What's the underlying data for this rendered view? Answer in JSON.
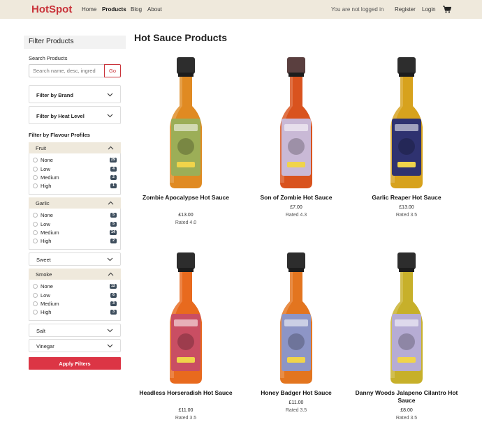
{
  "nav": {
    "brand": "HotSpot",
    "links": [
      "Home",
      "Products",
      "Blog",
      "About"
    ],
    "status": "You are not logged in",
    "register": "Register",
    "login": "Login",
    "cart_icon": "shopping-cart-icon"
  },
  "sidebar": {
    "title": "Filter Products",
    "search_label": "Search Products",
    "search_placeholder": "Search name, desc, ingred",
    "go_label": "Go",
    "brand_filter": "Filter by Brand",
    "heat_filter": "Filter by Heat Level",
    "flavour_title": "Filter by Flavour Profiles",
    "flavours": [
      {
        "name": "Fruit",
        "open": true,
        "options": [
          {
            "label": "None",
            "count": "29"
          },
          {
            "label": "Low",
            "count": "4"
          },
          {
            "label": "Medium",
            "count": "2"
          },
          {
            "label": "High",
            "count": "1"
          }
        ]
      },
      {
        "name": "Garlic",
        "open": true,
        "options": [
          {
            "label": "None",
            "count": "5"
          },
          {
            "label": "Low",
            "count": "5"
          },
          {
            "label": "Medium",
            "count": "14"
          },
          {
            "label": "High",
            "count": "2"
          }
        ]
      },
      {
        "name": "Sweet",
        "open": false
      },
      {
        "name": "Smoke",
        "open": true,
        "options": [
          {
            "label": "None",
            "count": "12"
          },
          {
            "label": "Low",
            "count": "6"
          },
          {
            "label": "Medium",
            "count": "3"
          },
          {
            "label": "High",
            "count": "3"
          }
        ]
      },
      {
        "name": "Salt",
        "open": false
      },
      {
        "name": "Vinegar",
        "open": false
      }
    ],
    "apply_label": "Apply Filters"
  },
  "main": {
    "title": "Hot Sauce Products",
    "products": [
      {
        "name": "Zombie Apocalypse Hot Sauce",
        "price": "£13.00",
        "rating": "Rated 4.0",
        "liquid": "#e08a22",
        "label": "#9cae57",
        "cap": "#2d2d2d"
      },
      {
        "name": "Son of Zombie Hot Sauce",
        "price": "£7.00",
        "rating": "Rated 4.3",
        "liquid": "#d9531e",
        "label": "#c9b9d6",
        "cap": "#5a3f3f"
      },
      {
        "name": "Garlic Reaper Hot Sauce",
        "price": "£13.00",
        "rating": "Rated 3.5",
        "liquid": "#d7a21d",
        "label": "#2f3270",
        "cap": "#2d2d2d"
      },
      {
        "name": "Headless Horseradish Hot Sauce",
        "price": "£11.00",
        "rating": "Rated 3.5",
        "liquid": "#e86a1e",
        "label": "#c94e63",
        "cap": "#2d2d2d"
      },
      {
        "name": "Honey Badger Hot Sauce",
        "price": "£11.00",
        "rating": "Rated 3.5",
        "liquid": "#e3751f",
        "label": "#8d95c6",
        "cap": "#2d2d2d"
      },
      {
        "name": "Danny Woods Jalapeno Cilantro Hot Sauce",
        "price": "£8.00",
        "rating": "Rated 3.5",
        "liquid": "#c7b02a",
        "label": "#b6acd4",
        "cap": "#2d2d2d"
      }
    ]
  }
}
